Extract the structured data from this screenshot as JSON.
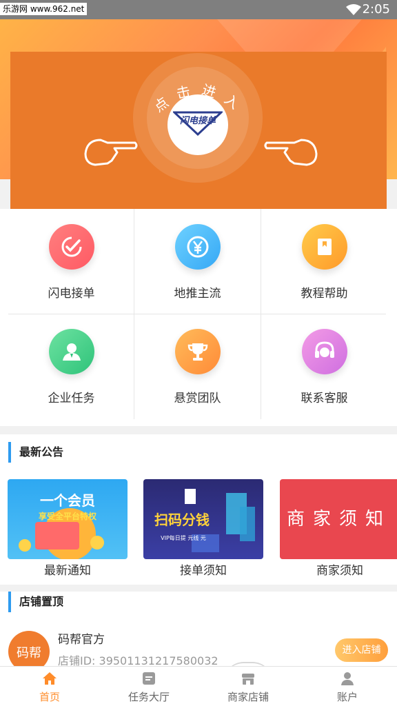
{
  "status_bar": {
    "watermark": "乐游网 www.962.net",
    "time": "2:05"
  },
  "banner": {
    "arc_text": "点击进入",
    "logo_text": "闪电接单"
  },
  "grid": {
    "items": [
      {
        "label": "闪电接单",
        "icon": "check-icon",
        "color_from": "#ff7f7f",
        "color_to": "#ff5a64"
      },
      {
        "label": "地推主流",
        "icon": "yen-icon",
        "color_from": "#6ed1ff",
        "color_to": "#35a8f5"
      },
      {
        "label": "教程帮助",
        "icon": "book-icon",
        "color_from": "#ffcb4a",
        "color_to": "#ff9a2a"
      },
      {
        "label": "企业任务",
        "icon": "person-icon",
        "color_from": "#6de2a1",
        "color_to": "#2fc37a"
      },
      {
        "label": "悬赏团队",
        "icon": "trophy-icon",
        "color_from": "#ffbb5a",
        "color_to": "#ff8b38"
      },
      {
        "label": "联系客服",
        "icon": "headset-icon",
        "color_from": "#f39be6",
        "color_to": "#cf6fe0"
      }
    ]
  },
  "notices": {
    "title": "最新公告",
    "cards": [
      {
        "label": "最新通知",
        "image_text": "一个会员",
        "image_subtext": "享受全平台特权"
      },
      {
        "label": "接单须知",
        "image_text": "扫码分钱",
        "image_subtext": "VIP每日提 元线 元"
      },
      {
        "label": "商家须知",
        "image_text": "商家须知"
      }
    ]
  },
  "shops": {
    "title": "店铺置顶",
    "items": [
      {
        "avatar_text": "码帮",
        "name": "码帮官方",
        "id_text": "店铺ID: 39501131217580032",
        "button": "进入店铺"
      }
    ]
  },
  "tabbar": {
    "tabs": [
      {
        "label": "首页",
        "icon": "home-icon",
        "active": true
      },
      {
        "label": "任务大厅",
        "icon": "task-icon",
        "active": false
      },
      {
        "label": "商家店铺",
        "icon": "store-icon",
        "active": false
      },
      {
        "label": "账户",
        "icon": "account-icon",
        "active": false
      }
    ]
  },
  "colors": {
    "accent": "#ff8c2a",
    "section_bar": "#2e9bf0",
    "banner": "#ea7a2a"
  }
}
